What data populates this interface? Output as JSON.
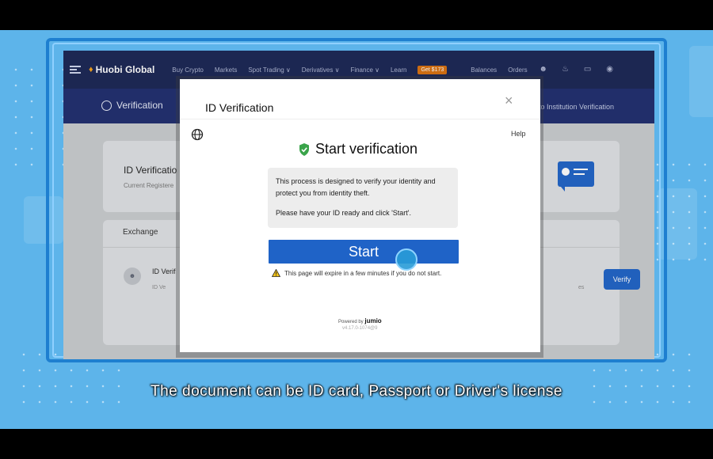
{
  "nav": {
    "logo_text": "Huobi Global",
    "items": [
      "Buy Crypto",
      "Markets",
      "Spot Trading ∨",
      "Derivatives ∨",
      "Finance ∨",
      "Learn"
    ],
    "badge": "Get $173",
    "right_items": [
      "Balances",
      "Orders"
    ],
    "icons": [
      "user-icon",
      "bell-icon",
      "download-icon",
      "globe-icon"
    ]
  },
  "subnav": {
    "verification_label": "Verification",
    "institution_label": "to Institution Verification"
  },
  "card1": {
    "title": "ID Verificatio",
    "subtitle": "Current Registere"
  },
  "card2": {
    "tab_label": "Exchange",
    "row_title": "ID Verif",
    "row_sub": "ID Ve",
    "row_side": "es",
    "verify_label": "Verify"
  },
  "modal": {
    "title": "ID Verification",
    "close_glyph": "×",
    "help_label": "Help",
    "heading": "Start verification",
    "info_line1": "This process is designed to verify your identity and protect you from identity theft.",
    "info_line2": "Please have your ID ready and click 'Start'.",
    "start_label": "Start",
    "warning": "This page will expire in a few minutes if you do not start.",
    "powered_by": "Powered by",
    "powered_brand": "jumio",
    "version": "v4.17.0-1074@9"
  },
  "caption": "The document can be ID card, Passport or Driver's license",
  "colors": {
    "accent_blue": "#1f63c7",
    "nav_dark": "#1a2554",
    "bg_blue": "#5db4ea"
  }
}
